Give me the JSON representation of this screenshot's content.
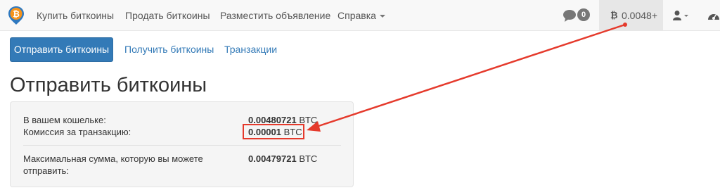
{
  "navbar": {
    "links": [
      {
        "label": "Купить биткоины"
      },
      {
        "label": "Продать биткоины"
      },
      {
        "label": "Разместить объявление"
      },
      {
        "label": "Справка"
      }
    ],
    "chat_badge": "0",
    "balance": "0.0048+",
    "balance_symbol": "₿"
  },
  "subnav": {
    "send": "Отправить биткоины",
    "receive": "Получить биткоины",
    "transactions": "Транзакции"
  },
  "page": {
    "title": "Отправить биткоины"
  },
  "wallet": {
    "balance_label": "В вашем кошельке:",
    "balance_value": "0.00480721",
    "fee_label": "Комиссия за транзакцию:",
    "fee_value": "0.00001",
    "max_label_1": "Максимальная сумма, которую вы можете",
    "max_label_2": "отправить:",
    "max_value": "0.00479721",
    "unit": "BTC"
  },
  "colors": {
    "accent": "#337ab7",
    "annotation": "#e53a2c"
  }
}
